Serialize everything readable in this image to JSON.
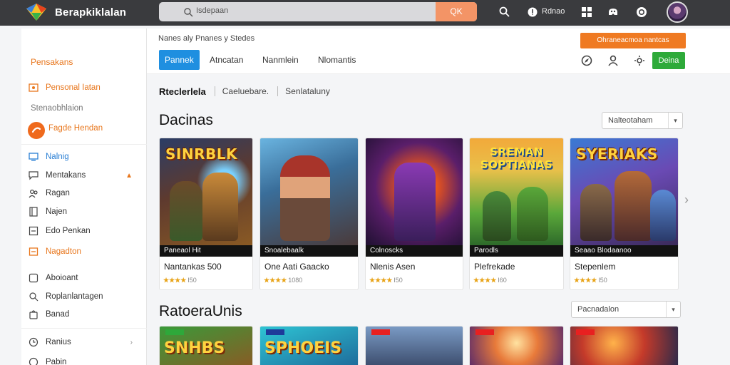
{
  "app": {
    "title": "Berapkiklalan"
  },
  "search": {
    "placeholder": "Isdepaan",
    "button": "QK"
  },
  "topbar": {
    "notif_label": "Rdnao"
  },
  "sidebar": {
    "header": "Pensakans",
    "item_personal": "Pensonal Iatan",
    "section": "Stenaobhlaion",
    "featured": "Fagde Hendan",
    "items": [
      {
        "label": "Nalnig"
      },
      {
        "label": "Mentakans"
      },
      {
        "label": "Ragan"
      },
      {
        "label": "Najen"
      },
      {
        "label": "Edo Penkan"
      },
      {
        "label": "Nagadton"
      },
      {
        "label": "Aboioant"
      },
      {
        "label": "Roplanlantagen"
      },
      {
        "label": "Banad"
      },
      {
        "label": "Ranius"
      },
      {
        "label": "Pabin"
      }
    ]
  },
  "main": {
    "breadcrumb": "Nanes aly Pnanes y Stedes",
    "tabs": [
      {
        "label": "Pannek"
      },
      {
        "label": "Atncatan"
      },
      {
        "label": "Nanmlein"
      },
      {
        "label": "Nlomantis"
      }
    ],
    "promo": "Ohraneacmoa nantcas",
    "green_button": "Deina",
    "filters": [
      "Rteclerlela",
      "Caeluebare.",
      "Senlataluny"
    ],
    "section1": {
      "title": "Dacinas",
      "sort": "Nalteotaham"
    },
    "section2": {
      "title": "RatoeraUnis",
      "sort": "Pacnadalon"
    },
    "cards": [
      {
        "art_title": "SINRBLK",
        "caption": "Paneaol Hit",
        "name": "Nantankas 500",
        "stars": "★★★★",
        "score": "I50"
      },
      {
        "art_title": "",
        "caption": "Snoalebaalk",
        "name": "One Aati Gaacko",
        "stars": "★★★★",
        "score": "1080"
      },
      {
        "art_title": "",
        "caption": "Colnoscks",
        "name": "Nlenis Asen",
        "stars": "★★★★",
        "score": "I50"
      },
      {
        "art_title": "SREMAN SOPTIANAS",
        "caption": "Parodls",
        "name": "Plefrekade",
        "stars": "★★★★",
        "score": "I60"
      },
      {
        "art_title": "SYERIAKS",
        "caption": "Seaao Blodaanoo",
        "name": "Stepenlem",
        "stars": "★★★★",
        "score": "I50"
      }
    ],
    "cards2": [
      {
        "art_title": "SNHBS"
      },
      {
        "art_title": "SPHOEIS"
      },
      {
        "art_title": ""
      },
      {
        "art_title": ""
      },
      {
        "art_title": ""
      }
    ]
  },
  "colors": {
    "accent": "#ef7a22",
    "primary": "#1f8fe0",
    "topbar": "#3a3b3e",
    "success": "#2eaa3a"
  }
}
